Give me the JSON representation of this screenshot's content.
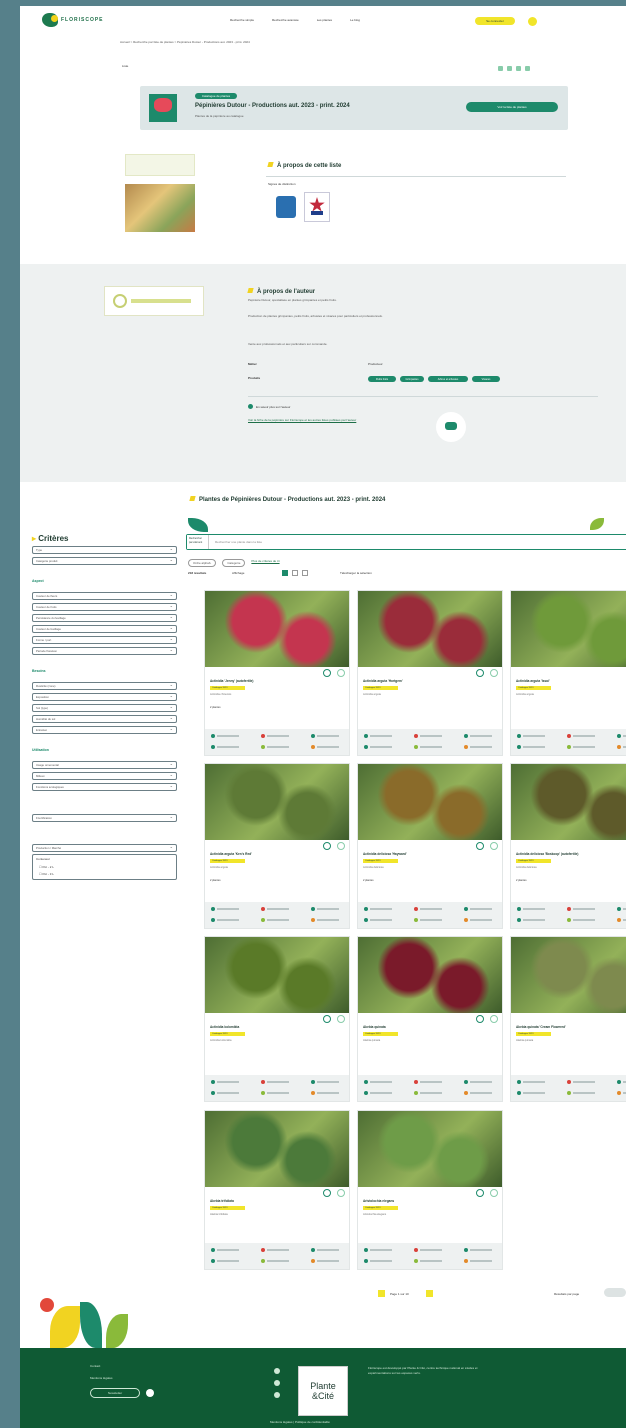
{
  "header": {
    "brand": "FLORISCOPE",
    "nav": [
      "Recherche simple",
      "Recherche avancée",
      "Les plantes",
      "Le blog"
    ],
    "cta_label": "Se connecter"
  },
  "breadcrumb": "Accueil > Recherche par liste de plantes > Pépinières Dutour - Productions aut. 2023 - print. 2024",
  "list_label": "Liste",
  "banner": {
    "tag": "Catalogue de plantes",
    "title": "Pépinières Dutour - Productions aut. 2023 - print. 2024",
    "subtitle": "Plantes de la pépinière au catalogue",
    "button": "Voir la liste de plantes"
  },
  "about_list": {
    "title": "À propos de cette liste",
    "labels_heading": "Signes de distinction"
  },
  "about_author": {
    "title": "À propos de l'auteur",
    "p1": "Pépinière Dutour, spécialisée en plantes grimpantes et petits fruits.",
    "p2": "Production de plantes grimpantes, petits fruits, arbustes et vivaces pour particuliers et professionnels.",
    "p3": "Vente aux professionnels et aux particuliers sur commande.",
    "meta_type_label": "Métier",
    "meta_type_value": "Producteur",
    "meta_prod_label": "Produits",
    "tags": [
      "Petits fruits",
      "Grimpantes",
      "Arbres et arbustes",
      "Vivaces"
    ],
    "note": "En savoir plus sur l'auteur",
    "links": "Voir la fiche de la pépinière sur Floriscope et les autres listes publiées par l'auteur"
  },
  "list_section_title": "Plantes de Pépinières Dutour - Productions aut. 2023 - print. 2024",
  "sidebar": {
    "title": "Critères",
    "top": [
      "Type",
      "Catégorie produit"
    ],
    "g1": "Aspect",
    "g1_items": [
      "Couleur de fleurs",
      "Couleur de fruits",
      "Persistance du feuillage",
      "Couleur de feuillage",
      "Forme / port",
      "Période floraison"
    ],
    "g2": "Besoins",
    "g2_items": [
      "Rusticité (zone)",
      "Exposition",
      "Sol (type)",
      "Humidité du sol",
      "Entretien"
    ],
    "g3": "Utilisation",
    "g3_items": [
      "Usage ornemental",
      "Milieux",
      "Fonctions écologiques"
    ],
    "single": "Fructification",
    "last_top": "Production / Marché",
    "last_label": "Conteneur",
    "opts": [
      "Pot - 2 L",
      "Pot - 3 L"
    ]
  },
  "search": {
    "placeholder": "Rechercher une plante dans la liste",
    "left_tag": "Rechercher par élément"
  },
  "sort": {
    "a": "Ordre alphab.",
    "b": "Catégorie",
    "more": "Plus de critères de tri",
    "count": "218 résultats",
    "view": "Affichage",
    "pdf": "Télécharger la sélection"
  },
  "cards": [
    {
      "name": "Actinidia 'Jenny' (autofertile)",
      "badge": "Catalogue 2023",
      "latin": "Actinidia chinensis",
      "extra": "2 plantes",
      "img": "#c4354f"
    },
    {
      "name": "Actinidia arguta 'Hortgem'",
      "badge": "Catalogue 2023",
      "latin": "Actinidia arguta",
      "extra": "",
      "img": "#9a2c3a"
    },
    {
      "name": "Actinidia arguta 'Issai'",
      "badge": "Catalogue 2023",
      "latin": "Actinidia arguta",
      "extra": "",
      "img": "#6f9a3a"
    },
    {
      "name": "Actinidia arguta 'Ken's Red'",
      "badge": "Catalogue 2023",
      "latin": "Actinidia arguta",
      "extra": "2 plantes",
      "img": "#5e7a36"
    },
    {
      "name": "Actinidia deliciosa 'Hayward'",
      "badge": "Catalogue 2023",
      "latin": "Actinidia deliciosa",
      "extra": "2 plantes",
      "img": "#8a6b2a"
    },
    {
      "name": "Actinidia deliciosa 'Boskoop' (autofertile)",
      "badge": "Catalogue 2023",
      "latin": "Actinidia deliciosa",
      "extra": "2 plantes",
      "img": "#5e5a2a"
    },
    {
      "name": "Actinidia kolomikta",
      "badge": "Catalogue 2023",
      "latin": "Actinidia kolomikta",
      "extra": "",
      "img": "#5a7a28"
    },
    {
      "name": "Akebia quinata",
      "badge": "Catalogue 2023",
      "latin": "Akebia quinata",
      "extra": "",
      "img": "#7a1a2a"
    },
    {
      "name": "Akebia quinata 'Cream Flowered'",
      "badge": "Catalogue 2023",
      "latin": "Akebia quinata",
      "extra": "",
      "img": "#7e8a4e"
    },
    {
      "name": "Akebia trifoliata",
      "badge": "Catalogue 2023",
      "latin": "Akebia trifoliata",
      "extra": "",
      "img": "#4c7a3a"
    },
    {
      "name": "Aristolochia elegans",
      "badge": "Catalogue 2023",
      "latin": "Aristolochia elegans",
      "extra": "",
      "img": "#6e9c48"
    }
  ],
  "pager": {
    "label": "Page 1 sur 10",
    "per_page": "Résultats par page"
  },
  "footer": {
    "links": [
      "Contact",
      "Mentions légales",
      "Newsletter"
    ],
    "partner_top": "Plante",
    "partner_bottom": "&Cité",
    "partner_text": "Floriscope est développé par Plante & Cité, centre technique national en études et expérimentations sur les espaces verts.",
    "bottom": "Mentions légales | Politique de confidentialité"
  }
}
